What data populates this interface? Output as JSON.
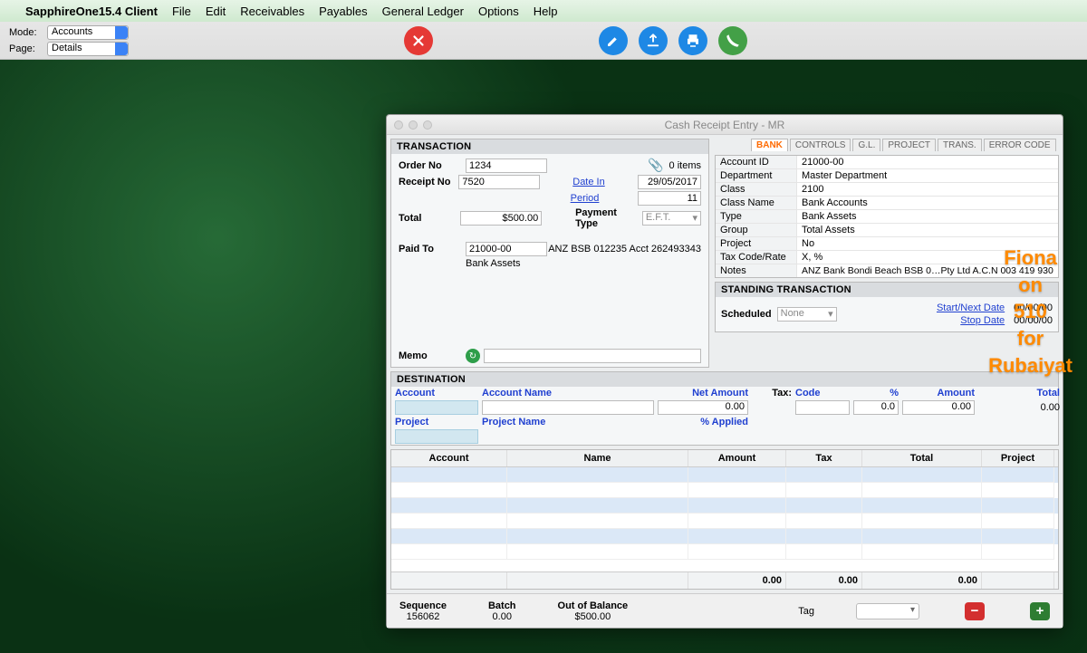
{
  "menubar": {
    "appname": "SapphireOne15.4 Client",
    "items": [
      "File",
      "Edit",
      "Receivables",
      "Payables",
      "General Ledger",
      "Options",
      "Help"
    ]
  },
  "toolbar": {
    "mode_label": "Mode:",
    "mode_value": "Accounts",
    "page_label": "Page:",
    "page_value": "Details"
  },
  "modal": {
    "title": "Cash Receipt Entry - MR",
    "transaction": {
      "header": "TRANSACTION",
      "order_no_label": "Order No",
      "order_no": "1234",
      "items_count_label": "0 items",
      "receipt_no_label": "Receipt No",
      "receipt_no": "7520",
      "date_in_label": "Date In",
      "date_in": "29/05/2017",
      "period_label": "Period",
      "period": "11",
      "total_label": "Total",
      "total": "$500.00",
      "payment_type_label": "Payment Type",
      "payment_type": "E.F.T.",
      "paid_to_label": "Paid To",
      "paid_to_acct": "21000-00",
      "paid_to_name": "Bank Assets",
      "paid_to_detail": "ANZ BSB 012235 Acct 262493343",
      "memo_label": "Memo",
      "memo": ""
    },
    "tabs": [
      "BANK",
      "CONTROLS",
      "G.L.",
      "PROJECT",
      "TRANS.",
      "ERROR CODE"
    ],
    "account_info": {
      "Account ID": "21000-00",
      "Department": "Master Department",
      "Class": "2100",
      "Class Name": "Bank Accounts",
      "Type": "Bank Assets",
      "Group": "Total Assets",
      "Project": "No",
      "Tax Code/Rate": "X, %",
      "Notes": "ANZ Bank Bondi Beach BSB 0…Pty Ltd A.C.N 003 419 930"
    },
    "standing": {
      "header": "STANDING TRANSACTION",
      "scheduled_label": "Scheduled",
      "scheduled_value": "None",
      "start_label": "Start/Next Date",
      "start_value": "00/00/00",
      "stop_label": "Stop Date",
      "stop_value": "00/00/00"
    },
    "destination": {
      "header": "DESTINATION",
      "cols": {
        "account": "Account",
        "account_name": "Account Name",
        "net_amount": "Net Amount",
        "tax": "Tax:",
        "code": "Code",
        "pct": "%",
        "amount": "Amount",
        "total": "Total"
      },
      "row1": {
        "net_amount": "0.00",
        "pct": "0.0",
        "amount": "0.00",
        "total": "0.00"
      },
      "proj_label": "Project",
      "projname_label": "Project Name",
      "applied_label": "% Applied"
    },
    "table": {
      "cols": [
        "Account",
        "Name",
        "Amount",
        "Tax",
        "Total",
        "Project"
      ],
      "footer": {
        "amount": "0.00",
        "tax": "0.00",
        "total": "0.00"
      }
    },
    "footer": {
      "sequence_label": "Sequence",
      "sequence": "156062",
      "batch_label": "Batch",
      "batch": "0.00",
      "oob_label": "Out of Balance",
      "oob": "$500.00",
      "tag_label": "Tag"
    }
  },
  "overlay": {
    "line1": "Fiona",
    "line2": "on",
    "line3": "510",
    "line4": "for",
    "line5": "Rubaiyat"
  }
}
